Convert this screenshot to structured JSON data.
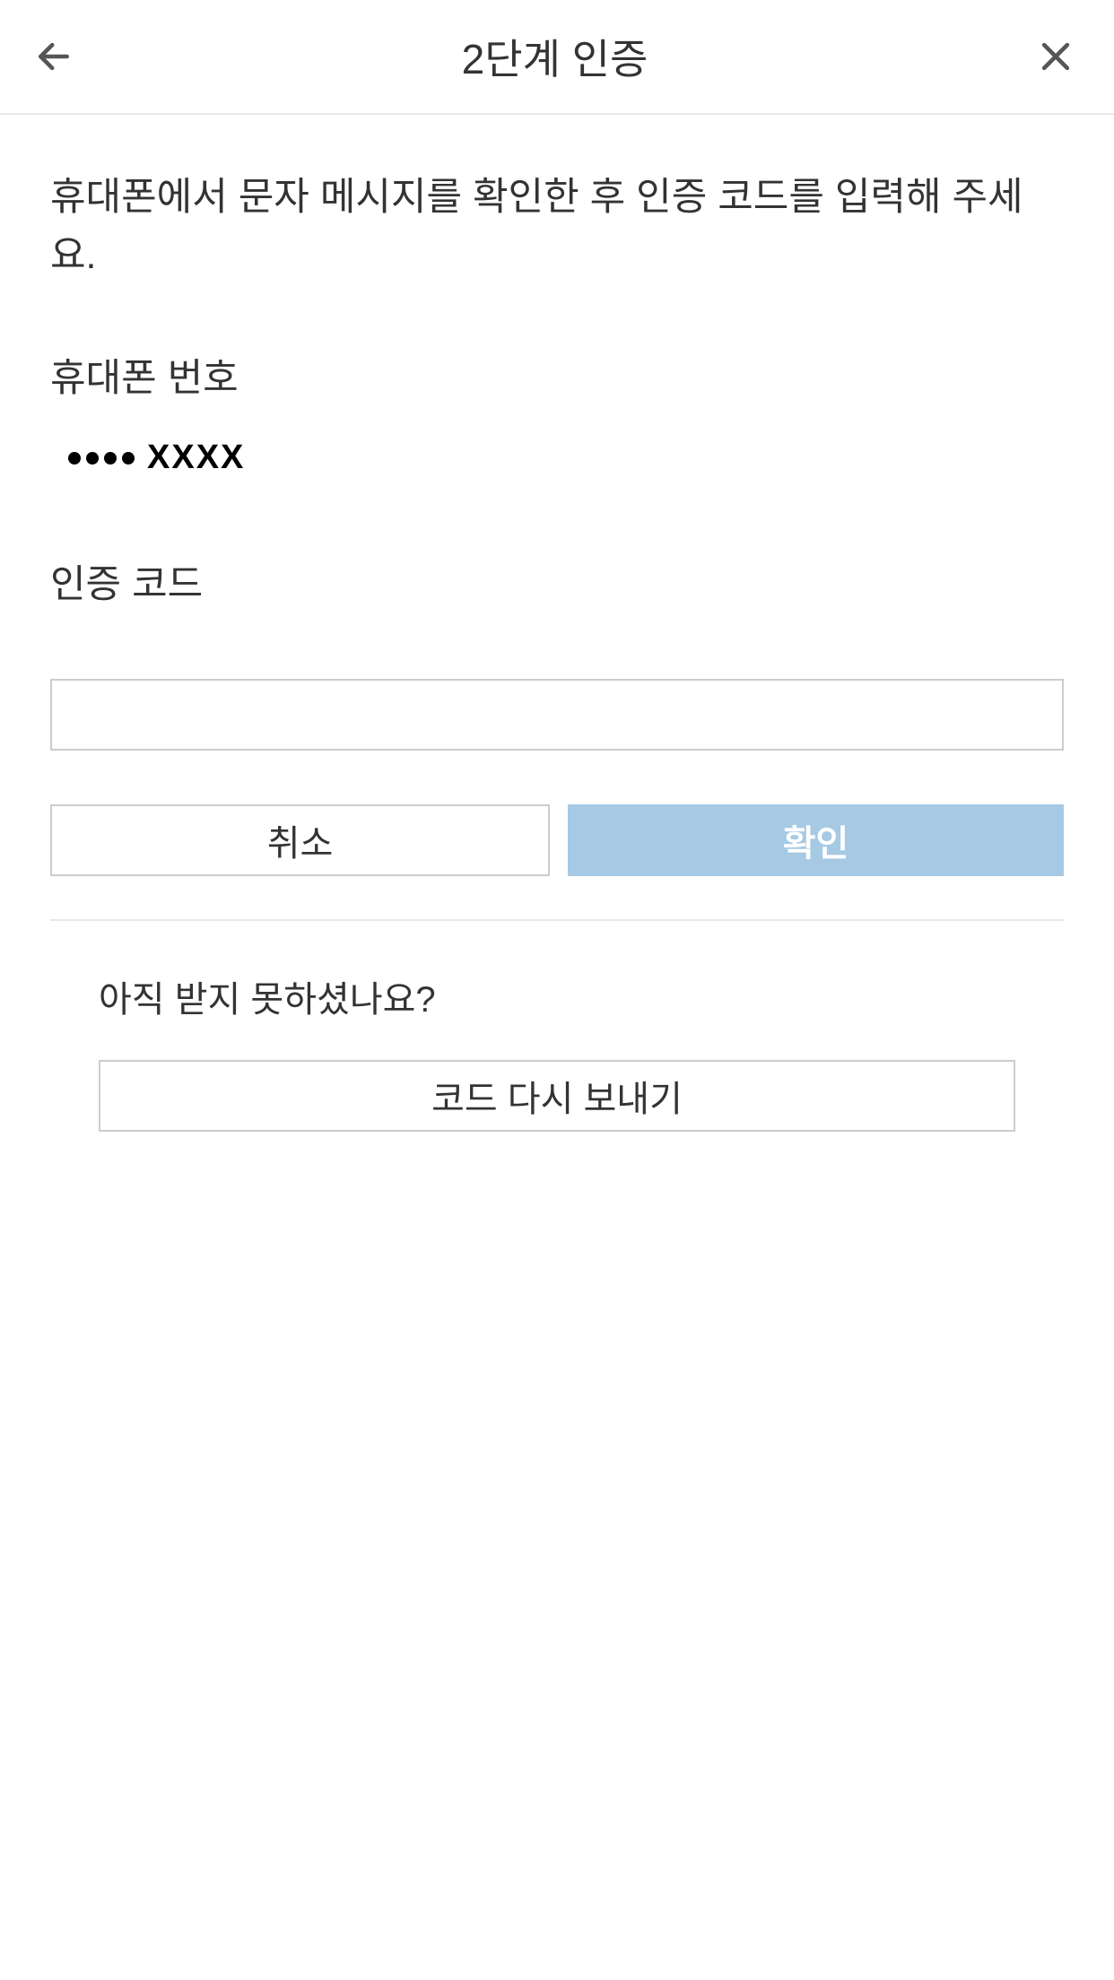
{
  "header": {
    "title": "2단계 인증"
  },
  "main": {
    "instruction": "휴대폰에서 문자 메시지를 확인한 후 인증 코드를 입력해 주세요.",
    "phone_label": "휴대폰 번호",
    "phone_masked_suffix": "XXXX",
    "code_label": "인증 코드",
    "code_value": ""
  },
  "buttons": {
    "cancel": "취소",
    "confirm": "확인"
  },
  "resend": {
    "question": "아직 받지 못하셨나요?",
    "button": "코드 다시 보내기"
  }
}
